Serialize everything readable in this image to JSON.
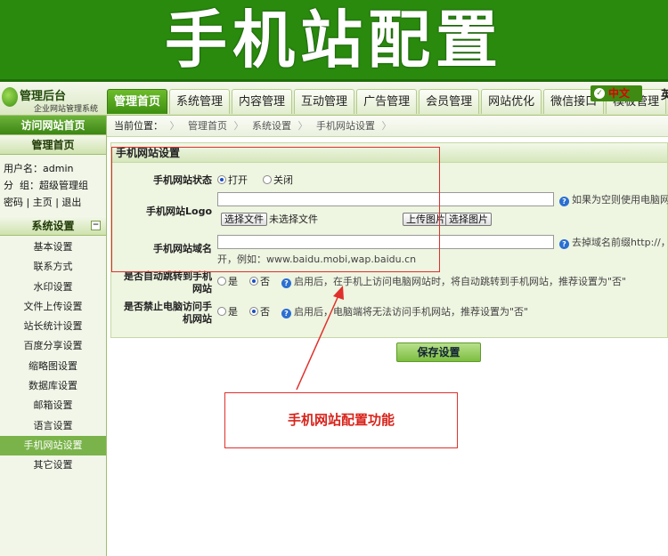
{
  "banner": {
    "title": "手机站配置"
  },
  "logo": {
    "title": "管理后台",
    "subtitle": "企业网站管理系统"
  },
  "nav": {
    "items": [
      "管理首页",
      "系统管理",
      "内容管理",
      "互动管理",
      "广告管理",
      "会员管理",
      "网站优化",
      "微信接口",
      "模板管理"
    ]
  },
  "lang": {
    "zh": "中文",
    "en": "英"
  },
  "sidebar": {
    "home_link": "访问网站首页",
    "home_header": "管理首页",
    "username_label": "用户名：",
    "username": "admin",
    "group_label": "分  组：",
    "group": "超级管理组",
    "links": [
      "密码",
      "主页",
      "退出"
    ],
    "section_header": "系统设置",
    "collapse": "−",
    "items": [
      "基本设置",
      "联系方式",
      "水印设置",
      "文件上传设置",
      "站长统计设置",
      "百度分享设置",
      "缩略图设置",
      "数据库设置",
      "邮箱设置",
      "语言设置",
      "手机网站设置",
      "其它设置"
    ]
  },
  "breadcrumb": {
    "prefix": "当前位置：",
    "items": [
      "管理首页",
      "系统设置",
      "手机网站设置"
    ]
  },
  "panel": {
    "title": "手机网站设置",
    "status": {
      "label": "手机网站状态",
      "options": [
        "打开",
        "关闭"
      ],
      "selected": "打开"
    },
    "logo": {
      "label": "手机网站Logo",
      "hint": "如果为空则使用电脑网站",
      "choose_file": "选择文件",
      "no_file": "未选择文件",
      "upload": "上传图片",
      "pick": "选择图片"
    },
    "domain": {
      "label": "手机网站域名",
      "hint": "去掉域名前缀http://，多",
      "example_line": "开，例如：www.baidu.mobi,wap.baidu.cn"
    },
    "auto_jump": {
      "label1": "是否自动跳转到手机",
      "label2": "网站",
      "options": [
        "是",
        "否"
      ],
      "selected": "否",
      "hint": "启用后，在手机上访问电脑网站时，将自动跳转到手机网站，推荐设置为\"否\""
    },
    "forbid_pc": {
      "label1": "是否禁止电脑访问手",
      "label2": "机网站",
      "options": [
        "是",
        "否"
      ],
      "selected": "否",
      "hint": "启用后，电脑端将无法访问手机网站，推荐设置为\"否\""
    }
  },
  "save_button": "保存设置",
  "callout": "手机网站配置功能",
  "colors": {
    "brand_green": "#2a8a0e",
    "nav_active": "#3e8f10",
    "annotation_red": "#e0302c"
  }
}
